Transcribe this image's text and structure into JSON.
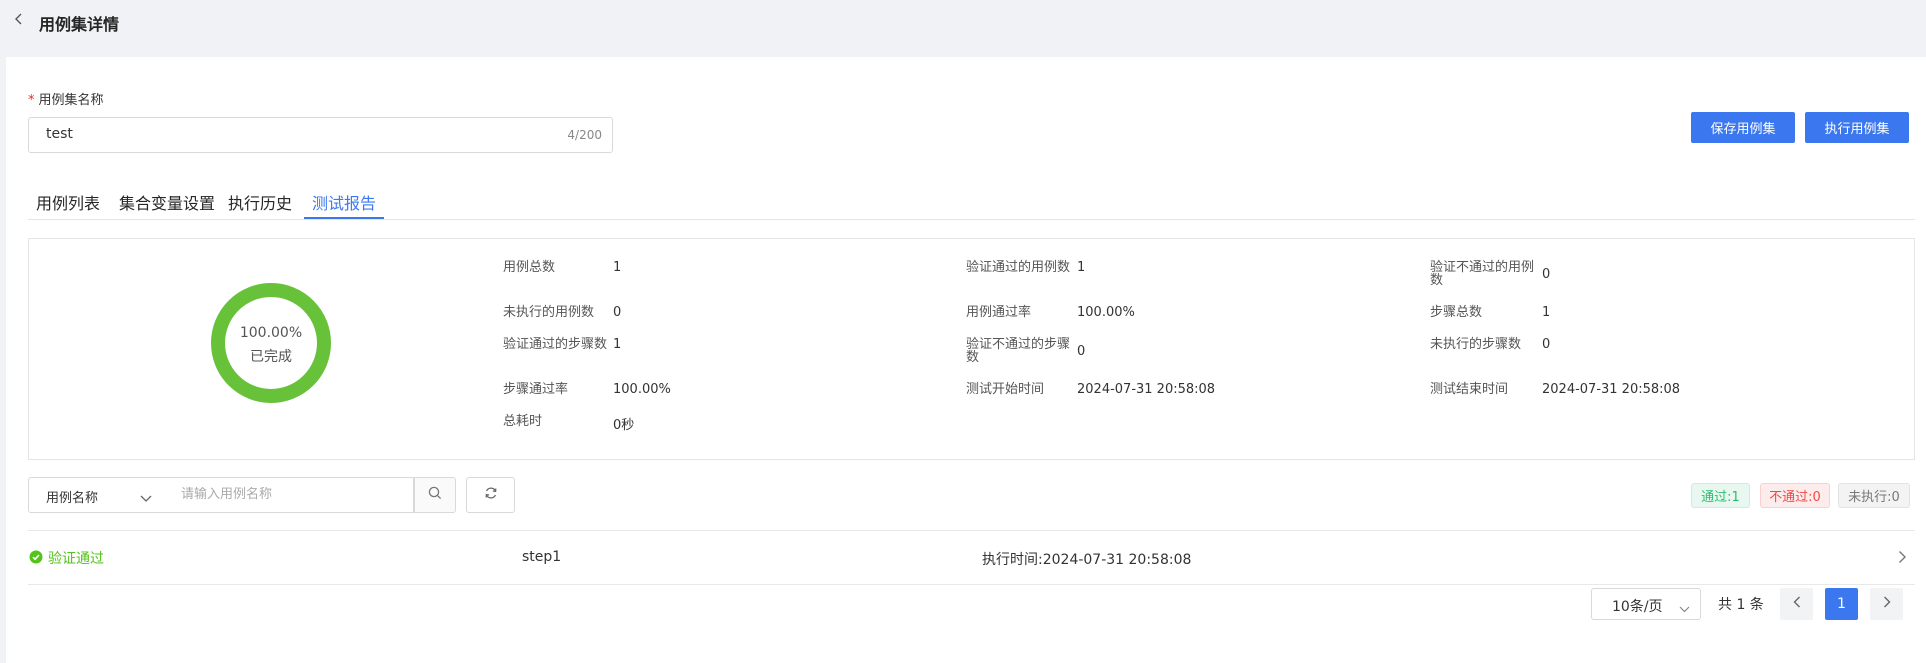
{
  "header": {
    "title": "用例集详情"
  },
  "form": {
    "name_label": "用例集名称",
    "required_mark": "*",
    "name_value": "test",
    "name_count": "4/200"
  },
  "actions": {
    "save_label": "保存用例集",
    "run_label": "执行用例集"
  },
  "tabs": [
    {
      "label": "用例列表",
      "active": false
    },
    {
      "label": "集合变量设置",
      "active": false
    },
    {
      "label": "执行历史",
      "active": false
    },
    {
      "label": "测试报告",
      "active": true
    }
  ],
  "report": {
    "percent": "100.00%",
    "status": "已完成",
    "progress": 1.0,
    "ring_color": "#67c23a",
    "stats": [
      {
        "label": "用例总数",
        "value": "1"
      },
      {
        "label": "验证通过的用例数",
        "value": "1"
      },
      {
        "label": "验证不通过的用例数",
        "value": "0"
      },
      {
        "label": "未执行的用例数",
        "value": "0"
      },
      {
        "label": "用例通过率",
        "value": "100.00%"
      },
      {
        "label": "步骤总数",
        "value": "1"
      },
      {
        "label": "验证通过的步骤数",
        "value": "1"
      },
      {
        "label": "验证不通过的步骤数",
        "value": "0"
      },
      {
        "label": "未执行的步骤数",
        "value": "0"
      },
      {
        "label": "步骤通过率",
        "value": "100.00%"
      },
      {
        "label": "测试开始时间",
        "value": "2024-07-31 20:58:08"
      },
      {
        "label": "测试结束时间",
        "value": "2024-07-31 20:58:08"
      },
      {
        "label": "总耗时",
        "value": "0秒"
      }
    ]
  },
  "filter": {
    "field_select": "用例名称",
    "search_placeholder": "请输入用例名称"
  },
  "tags": {
    "pass": "通过:1",
    "fail": "不通过:0",
    "not_run": "未执行:0"
  },
  "rows": [
    {
      "status": "验证通过",
      "name": "step1",
      "exec_time": "执行时间:2024-07-31 20:58:08"
    }
  ],
  "pagination": {
    "page_size": "10条/页",
    "total": "共 1 条",
    "current": "1"
  },
  "colors": {
    "primary": "#3b78f0",
    "success": "#52c41a",
    "danger": "#f04848"
  }
}
